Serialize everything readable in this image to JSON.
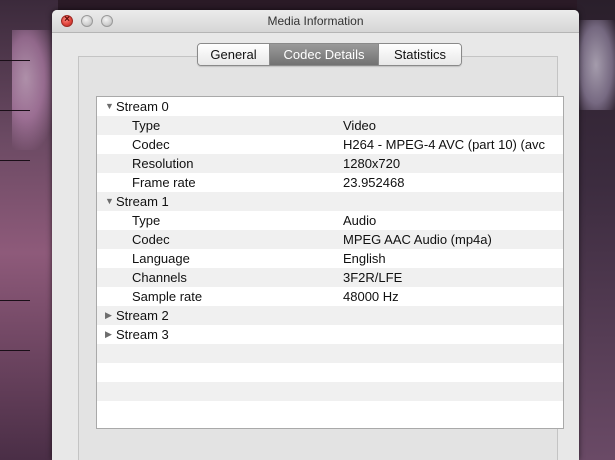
{
  "window": {
    "title": "Media Information"
  },
  "tabs": [
    {
      "label": "General",
      "active": false
    },
    {
      "label": "Codec Details",
      "active": true
    },
    {
      "label": "Statistics",
      "active": false
    }
  ],
  "streams": [
    {
      "label": "Stream 0",
      "expanded": true,
      "properties": [
        {
          "key": "Type",
          "value": "Video"
        },
        {
          "key": "Codec",
          "value": "H264 - MPEG-4 AVC (part 10) (avc"
        },
        {
          "key": "Resolution",
          "value": "1280x720"
        },
        {
          "key": "Frame rate",
          "value": "23.952468"
        }
      ]
    },
    {
      "label": "Stream 1",
      "expanded": true,
      "properties": [
        {
          "key": "Type",
          "value": "Audio"
        },
        {
          "key": "Codec",
          "value": "MPEG AAC Audio (mp4a)"
        },
        {
          "key": "Language",
          "value": "English"
        },
        {
          "key": "Channels",
          "value": "3F2R/LFE"
        },
        {
          "key": "Sample rate",
          "value": "48000 Hz"
        }
      ]
    },
    {
      "label": "Stream 2",
      "expanded": false,
      "properties": []
    },
    {
      "label": "Stream 3",
      "expanded": false,
      "properties": []
    }
  ],
  "icons": {
    "expanded": "▼",
    "collapsed": "▶",
    "close": "×"
  },
  "colors": {
    "active_tab": "#7f7f7f",
    "alt_row": "#f0f0f0",
    "close_button": "#e0443c"
  }
}
